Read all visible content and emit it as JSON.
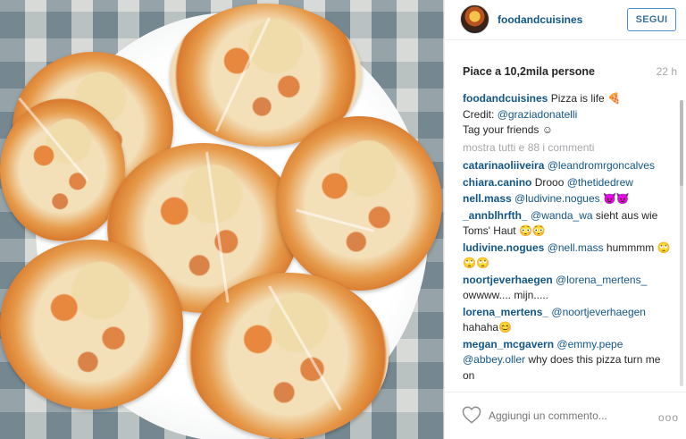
{
  "post": {
    "username": "foodandcuisines",
    "follow_label": "SEGUI",
    "likes": "Piace a 10,2mila persone",
    "time": "22 h"
  },
  "caption": {
    "username": "foodandcuisines",
    "text": "Pizza is life 🍕",
    "credit_prefix": "Credit:",
    "credit_mention": "@graziadonatelli",
    "line3": "Tag your friends ☺"
  },
  "more_comments": "mostra tutti e 88 i commenti",
  "comments": [
    {
      "user": "catarinaoliiveira",
      "mention": "@leandromrgoncalves",
      "text": ""
    },
    {
      "user": "chiara.canino",
      "mention": "",
      "text": "Drooo",
      "mention2": "@thetidedrew"
    },
    {
      "user": "nell.mass",
      "mention": "@ludivine.nogues",
      "text": "😈😈"
    },
    {
      "user": "_annblhrfth_",
      "mention": "@wanda_wa",
      "text": "sieht aus wie Toms' Haut 😳😳"
    },
    {
      "user": "ludivine.nogues",
      "mention": "@nell.mass",
      "text": "hummmm 🙄🙄🙄"
    },
    {
      "user": "noortjeverhaegen",
      "mention": "@lorena_mertens_",
      "text": "owwww.... mijn....."
    },
    {
      "user": "lorena_mertens_",
      "mention": "@noortjeverhaegen",
      "text": "hahaha😊"
    },
    {
      "user": "megan_mcgavern",
      "mention": "@emmy.pepe",
      "text": "why does this pizza turn me on",
      "mention2": "@abbey.oller"
    }
  ],
  "footer": {
    "placeholder": "Aggiungi un commento...",
    "more_options": "ooo"
  },
  "icons": {
    "heart": "heart-icon",
    "avatar": "avatar"
  },
  "colors": {
    "link": "#125688",
    "follow_border": "#4a8ed5",
    "muted": "#a5a7aa"
  }
}
